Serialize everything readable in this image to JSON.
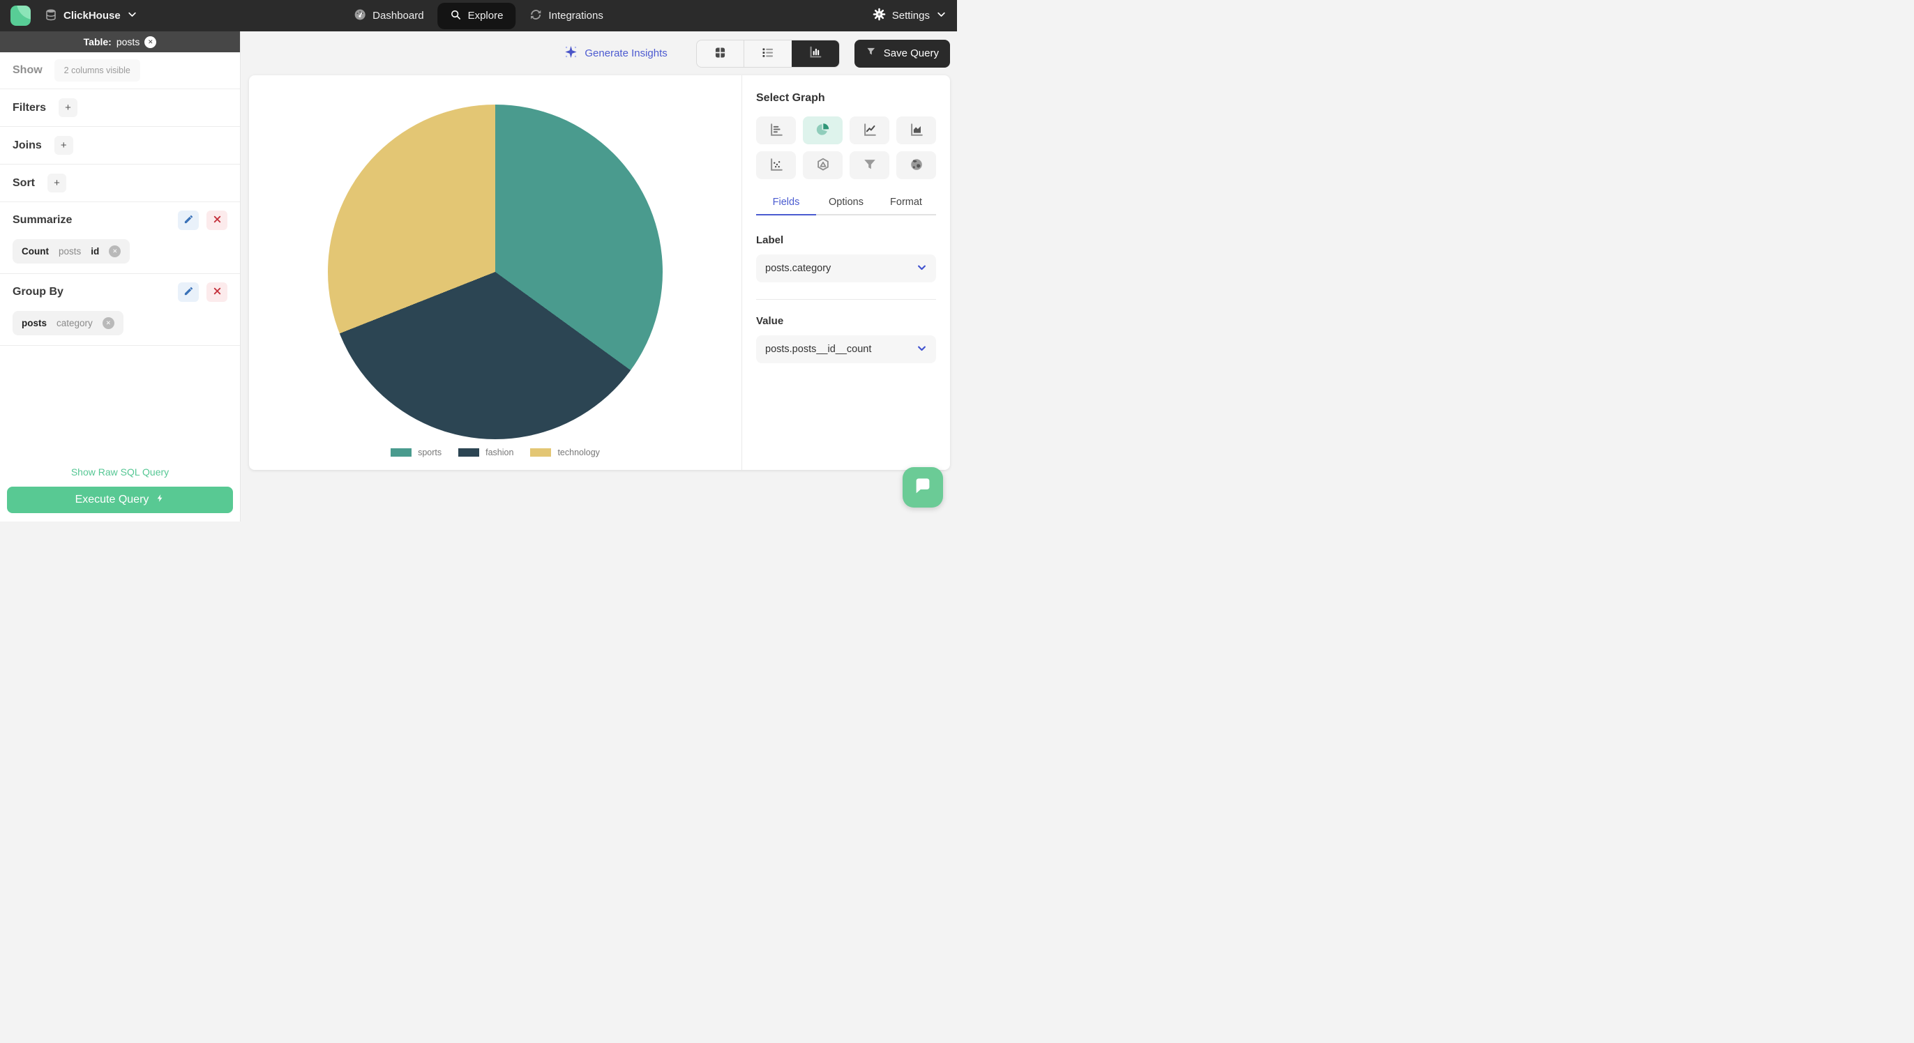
{
  "topbar": {
    "brand": "ClickHouse",
    "nav": [
      {
        "label": "Dashboard",
        "icon": "gauge-icon",
        "active": false
      },
      {
        "label": "Explore",
        "icon": "search-icon",
        "active": true
      },
      {
        "label": "Integrations",
        "icon": "sync-icon",
        "active": false
      }
    ],
    "settings_label": "Settings"
  },
  "sidebar": {
    "table_header": {
      "prefix": "Table:",
      "name": "posts"
    },
    "show": {
      "label": "Show",
      "summary": "2 columns visible"
    },
    "sections": [
      {
        "label": "Filters"
      },
      {
        "label": "Joins"
      },
      {
        "label": "Sort"
      }
    ],
    "summarize": {
      "label": "Summarize",
      "chip": {
        "agg": "Count",
        "table": "posts",
        "column": "id"
      }
    },
    "group_by": {
      "label": "Group By",
      "chip": {
        "table": "posts",
        "column": "category"
      }
    },
    "raw_sql_link": "Show Raw SQL Query",
    "execute_button": "Execute Query"
  },
  "toolbar": {
    "generate_insights": "Generate Insights",
    "save_query": "Save Query",
    "view_modes": [
      {
        "name": "table-view",
        "active": false
      },
      {
        "name": "list-view",
        "active": false
      },
      {
        "name": "chart-view",
        "active": true
      }
    ]
  },
  "graph_panel": {
    "title": "Select Graph",
    "graph_types": [
      {
        "name": "bar",
        "active": false
      },
      {
        "name": "pie",
        "active": true
      },
      {
        "name": "line",
        "active": false
      },
      {
        "name": "area",
        "active": false
      },
      {
        "name": "scatter",
        "active": false
      },
      {
        "name": "radar",
        "active": false
      },
      {
        "name": "funnel",
        "active": false
      },
      {
        "name": "map",
        "active": false
      }
    ],
    "tabs": [
      {
        "label": "Fields",
        "active": true
      },
      {
        "label": "Options",
        "active": false
      },
      {
        "label": "Format",
        "active": false
      }
    ],
    "label_field": {
      "label": "Label",
      "value": "posts.category"
    },
    "value_field": {
      "label": "Value",
      "value": "posts.posts__id__count"
    }
  },
  "chart_data": {
    "type": "pie",
    "categories": [
      "sports",
      "fashion",
      "technology"
    ],
    "values_percent": [
      35,
      34,
      31
    ],
    "colors": [
      "#4a9b8e",
      "#2c4553",
      "#e3c674"
    ],
    "title": "",
    "legend_position": "bottom"
  },
  "icon_glyphs": {
    "close": "✕",
    "plus": "+"
  },
  "colors": {
    "brand_green": "#58c993",
    "accent_indigo": "#4a5bd0",
    "topbar_bg": "#2b2b2b",
    "active_tile_bg": "#def3ec",
    "edit_blue": "#3a72b8",
    "delete_red": "#c5333e"
  }
}
